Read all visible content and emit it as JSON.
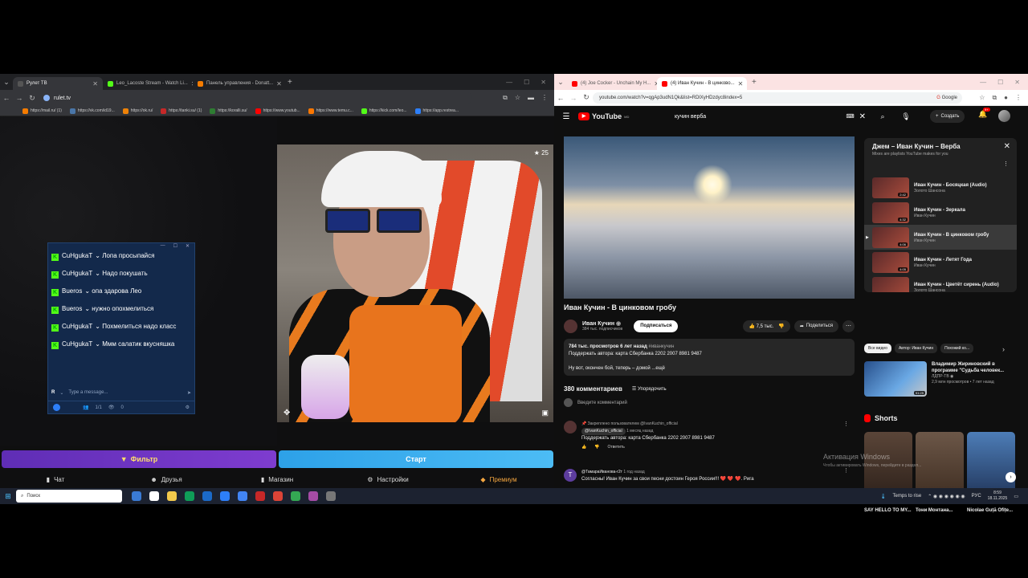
{
  "left_browser": {
    "tabs": [
      {
        "label": "Рулет ТВ",
        "color": "#222222",
        "active": true
      },
      {
        "label": "Leo_Lacoste Stream - Watch Li...",
        "color": "#53fc18",
        "active": false
      },
      {
        "label": "Панель управления - Donatt...",
        "color": "#f57c00",
        "active": false
      }
    ],
    "url": "rulet.tv",
    "bookmarks": [
      {
        "label": "https://mail.ru/ (1)",
        "color": "#f57c00"
      },
      {
        "label": "https://vk.com/id19...",
        "color": "#4a76a8"
      },
      {
        "label": "https://ok.ru/",
        "color": "#ee8208"
      },
      {
        "label": "https://tanki.su/ (1)",
        "color": "#c62828"
      },
      {
        "label": "https://koralli.su/",
        "color": "#2e7d32"
      },
      {
        "label": "https://www.youtub...",
        "color": "#ff0000"
      },
      {
        "label": "https://www.temu.c...",
        "color": "#fb7701"
      },
      {
        "label": "https://kick.com/leo...",
        "color": "#53fc18"
      },
      {
        "label": "https://app.restrea...",
        "color": "#2d7ff9"
      }
    ],
    "cam": {
      "star_count": "25"
    },
    "chat": {
      "messages": [
        {
          "nick": "CuHgukaT",
          "text": "Лопа просыпайся"
        },
        {
          "nick": "CuHgukaT",
          "text": "Надо покушать"
        },
        {
          "nick": "Bueros",
          "text": "опа здарова Лео"
        },
        {
          "nick": "Bueros",
          "text": "нужно опохмелиться"
        },
        {
          "nick": "CuHgukaT",
          "text": "Похмелиться надо класс"
        },
        {
          "nick": "CuHgukaT",
          "text": "Ммм салатик вкусняшка"
        }
      ],
      "input_placeholder": "Type a message...",
      "input_badge": "R",
      "footer_count": "1/1",
      "viewers": "0"
    },
    "filter_label": "Фильтр",
    "start_label": "Старт",
    "nav": [
      "Чат",
      "Друзья",
      "Магазин",
      "Настройки",
      "Премиум"
    ]
  },
  "right_browser": {
    "tabs": [
      {
        "label": "(4) Joe Cocker - Unchain My H...",
        "active": false
      },
      {
        "label": "(4) Иван Кучин - В цинково...",
        "active": true
      }
    ],
    "url": "youtube.com/watch?v=qgAp3udN1Qk&list=RDlXyHDzdyc8index=5",
    "google_label": "Google",
    "youtube": {
      "logo": "YouTube",
      "logo_region": "MD",
      "search_query": "кучин верба",
      "create_label": "Создать",
      "notifications": "9+",
      "video_title": "Иван Кучин - В цинковом гробу",
      "channel_name": "Иван Кучин",
      "channel_subs": "384 тыс. подписчиков",
      "subscribe_label": "Подписаться",
      "likes": "7,5 тыс.",
      "share_label": "Поделиться",
      "desc_stats": "784 тыс. просмотров  6 лет назад",
      "desc_tag": "#иванкучин",
      "desc_line2": "Поддержать автора: карта Сбербанка 2202 2007 8981 9487",
      "desc_line3": "Ну вот, окончен бой, теперь – домой ...ещё",
      "comments_count": "380 комментариев",
      "sort_label": "Упорядочить",
      "add_comment": "Введите комментарий",
      "pinned_label": "Закреплено пользователем @IvanKuchin_official",
      "pinned_author": "@IvanKuchin_official",
      "pinned_time": "1 месяц назад",
      "pinned_text": "Поддержать автора: карта Сбербанка 2202 2007 8981 9487",
      "reply_label": "Ответить",
      "comment2_avatar": "Т",
      "comment2_author": "@ТамараИванова-г2т",
      "comment2_time": "1 год назад",
      "comment2_text": "Согласны! Иван Кучин за свои песни достоин Героя России!!! ❤️ ❤️ ❤️. Рига",
      "mix": {
        "title": "Джем – Иван Кучин – Верба",
        "subtitle": "Mixes are playlists YouTube makes for you",
        "items": [
          {
            "title": "Иван Кучин - Босяцкая (Audio)",
            "channel": "Золото Шансона",
            "duration": "2:42",
            "active": false
          },
          {
            "title": "Иван Кучин - Зеркала",
            "channel": "Иван Кучин",
            "duration": "4:32",
            "active": false
          },
          {
            "title": "Иван Кучин - В цинковом гробу",
            "channel": "Иван Кучин",
            "duration": "4:06",
            "active": true
          },
          {
            "title": "Иван Кучин - Летят Года",
            "channel": "Иван Кучин",
            "duration": "4:05",
            "active": false
          },
          {
            "title": "Иван Кучин - Цветёт сирень (Audio)",
            "channel": "Золото Шансона",
            "duration": "4:13",
            "active": false
          }
        ]
      },
      "chips": [
        "Все видео",
        "Автор: Иван Кучин",
        "Похожий ко..."
      ],
      "rec": {
        "title": "Владимир Жириновский в программе \"Судьба человек...",
        "channel": "ЛДПР-ТВ",
        "stats": "2,9 млн просмотров • 7 лет назад",
        "duration": "51:25"
      },
      "shorts_label": "Shorts",
      "shorts": [
        "SAY HELLO TO MY...",
        "Тони Монтана...",
        "Nicolae Guță Ofițe..."
      ],
      "watermark_title": "Активация Windows",
      "watermark_sub": "Чтобы активировать Windows, перейдите в раздел..."
    }
  },
  "taskbar": {
    "search_placeholder": "Поиск",
    "weather": "Temps to rise",
    "lang": "РУС",
    "time": "8:59",
    "date": "18.11.2025"
  }
}
